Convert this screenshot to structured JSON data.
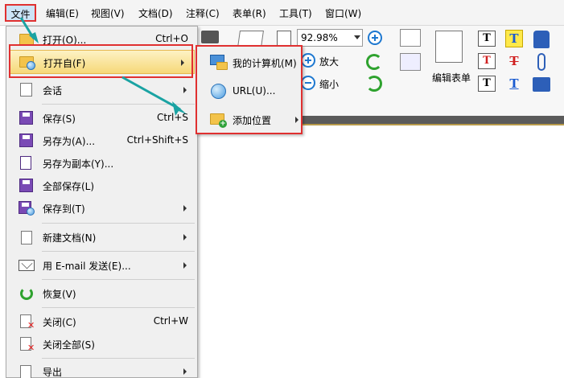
{
  "menubar": {
    "items": [
      "文件",
      "编辑(E)",
      "视图(V)",
      "文档(D)",
      "注释(C)",
      "表单(R)",
      "工具(T)",
      "窗口(W)"
    ]
  },
  "toolbar": {
    "zoom_value": "92.98%",
    "zoom_in_label": "放大",
    "zoom_out_label": "缩小",
    "edit_form_label": "编辑表单"
  },
  "file_menu": {
    "items": [
      {
        "label": "打开(O)...",
        "shortcut": "Ctrl+O",
        "submenu": false
      },
      {
        "label": "打开自(F)",
        "shortcut": "",
        "submenu": true
      },
      {
        "label": "会话",
        "shortcut": "",
        "submenu": true
      },
      {
        "label": "保存(S)",
        "shortcut": "Ctrl+S",
        "submenu": false
      },
      {
        "label": "另存为(A)...",
        "shortcut": "Ctrl+Shift+S",
        "submenu": false
      },
      {
        "label": "另存为副本(Y)...",
        "shortcut": "",
        "submenu": false
      },
      {
        "label": "全部保存(L)",
        "shortcut": "",
        "submenu": false
      },
      {
        "label": "保存到(T)",
        "shortcut": "",
        "submenu": true
      },
      {
        "label": "新建文档(N)",
        "shortcut": "",
        "submenu": true
      },
      {
        "label": "用 E-mail 发送(E)...",
        "shortcut": "",
        "submenu": true
      },
      {
        "label": "恢复(V)",
        "shortcut": "",
        "submenu": false
      },
      {
        "label": "关闭(C)",
        "shortcut": "Ctrl+W",
        "submenu": false
      },
      {
        "label": "关闭全部(S)",
        "shortcut": "",
        "submenu": false
      },
      {
        "label": "导出",
        "shortcut": "",
        "submenu": true
      }
    ]
  },
  "open_from_submenu": {
    "items": [
      {
        "label": "我的计算机(M)",
        "submenu": false
      },
      {
        "label": "URL(U)...",
        "submenu": false
      },
      {
        "label": "添加位置",
        "submenu": true
      }
    ]
  },
  "colors": {
    "highlight_border": "#e03030",
    "annotation_arrow": "#1aa3a3",
    "menu_hover": "#f6d879"
  }
}
